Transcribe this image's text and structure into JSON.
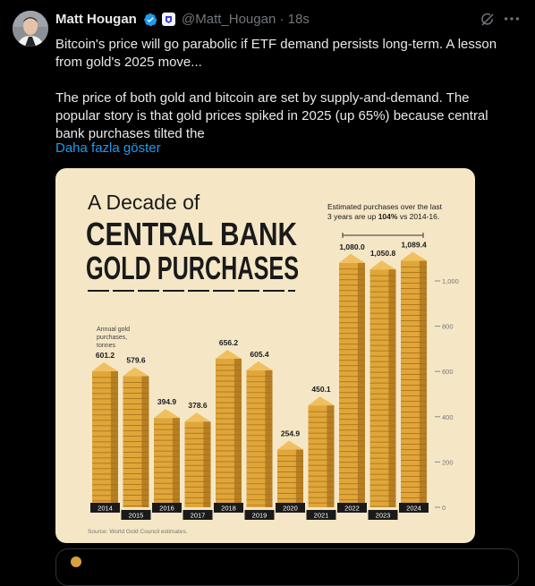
{
  "tweet": {
    "author_name": "Matt Hougan",
    "handle": "@Matt_Hougan",
    "separator": "·",
    "time": "18s",
    "paragraph1_line1": "Bitcoin's price will go parabolic if ETF demand persists long-term.  A lesson",
    "paragraph1_line2": "from gold's 2025 move...",
    "paragraph2_line1": "The price of both gold and bitcoin are set by supply-and-demand.  The",
    "paragraph2_line2": "popular story is that gold prices spiked in 2025 (up 65%) because central",
    "paragraph2_line3": "bank purchases tilted the",
    "show_more": "Daha fazla göster"
  },
  "icons": {
    "verified": "verified-badge-icon",
    "affiliate": "affiliate-badge-icon",
    "grok": "grok-icon",
    "more": "more-options-icon"
  },
  "colors": {
    "background": "#000000",
    "text": "#e7e9ea",
    "muted": "#71767b",
    "link": "#1d9bf0",
    "card_bg": "#f5e7c6",
    "gold": "#e0a63a",
    "dark": "#1a1a1a"
  },
  "infographic": {
    "title_line1": "A Decade of",
    "title_line2": "CENTRAL BANK",
    "title_line3": "GOLD PURCHASES",
    "note_line1": "Estimated purchases over the last",
    "note_line2_a": "3 years are up ",
    "note_line2_b": "104%",
    "note_line2_c": " vs 2014-16.",
    "unit_line1": "Annual gold",
    "unit_line2": "purchases,",
    "unit_line3": "tonnes",
    "source": "Source: World Gold Council estimates."
  },
  "chart_data": {
    "type": "bar",
    "categories": [
      "2014",
      "2015",
      "2016",
      "2017",
      "2018",
      "2019",
      "2020",
      "2021",
      "2022",
      "2023",
      "2024"
    ],
    "values": [
      601.2,
      579.6,
      394.9,
      378.6,
      656.2,
      605.4,
      254.9,
      450.1,
      1080.0,
      1050.8,
      1089.4
    ],
    "value_labels": [
      "601.2",
      "579.6",
      "394.9",
      "378.6",
      "656.2",
      "605.4",
      "254.9",
      "450.1",
      "1,080.0",
      "1,050.8",
      "1,089.4"
    ],
    "yticks": [
      0,
      200,
      400,
      600,
      800,
      1000
    ],
    "ytick_labels": [
      "0",
      "200",
      "400",
      "600",
      "800",
      "1,000"
    ],
    "ylim": [
      0,
      1100
    ],
    "title": "A Decade of CENTRAL BANK GOLD PURCHASES",
    "ylabel": "Annual gold purchases, tonnes",
    "grid": false
  }
}
